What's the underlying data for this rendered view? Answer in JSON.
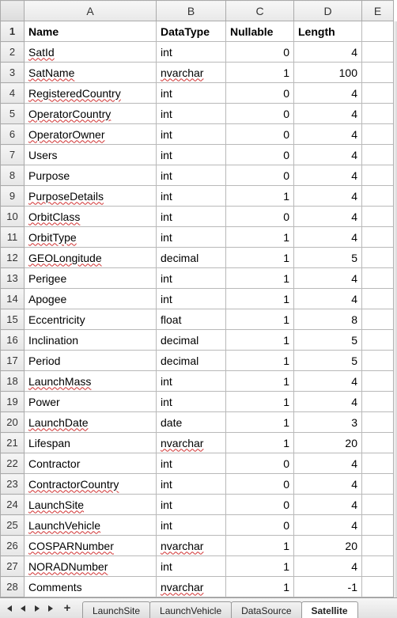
{
  "columns": [
    "A",
    "B",
    "C",
    "D",
    "E"
  ],
  "header_row": {
    "A": "Name",
    "B": "DataType",
    "C": "Nullable",
    "D": "Length"
  },
  "rows": [
    {
      "n": 2,
      "A": "SatId",
      "B": "int",
      "C": 0,
      "D": 4,
      "sqA": true
    },
    {
      "n": 3,
      "A": "SatName",
      "B": "nvarchar",
      "C": 1,
      "D": 100,
      "sqA": true,
      "sqB": true
    },
    {
      "n": 4,
      "A": "RegisteredCountry",
      "B": "int",
      "C": 0,
      "D": 4,
      "sqA": true
    },
    {
      "n": 5,
      "A": "OperatorCountry",
      "B": "int",
      "C": 0,
      "D": 4,
      "sqA": true
    },
    {
      "n": 6,
      "A": "OperatorOwner",
      "B": "int",
      "C": 0,
      "D": 4,
      "sqA": true
    },
    {
      "n": 7,
      "A": "Users",
      "B": "int",
      "C": 0,
      "D": 4
    },
    {
      "n": 8,
      "A": "Purpose",
      "B": "int",
      "C": 0,
      "D": 4
    },
    {
      "n": 9,
      "A": "PurposeDetails",
      "B": "int",
      "C": 1,
      "D": 4,
      "sqA": true
    },
    {
      "n": 10,
      "A": "OrbitClass",
      "B": "int",
      "C": 0,
      "D": 4,
      "sqA": true
    },
    {
      "n": 11,
      "A": "OrbitType",
      "B": "int",
      "C": 1,
      "D": 4,
      "sqA": true
    },
    {
      "n": 12,
      "A": "GEOLongitude",
      "B": "decimal",
      "C": 1,
      "D": 5,
      "sqA": true
    },
    {
      "n": 13,
      "A": "Perigee",
      "B": "int",
      "C": 1,
      "D": 4
    },
    {
      "n": 14,
      "A": "Apogee",
      "B": "int",
      "C": 1,
      "D": 4
    },
    {
      "n": 15,
      "A": "Eccentricity",
      "B": "float",
      "C": 1,
      "D": 8
    },
    {
      "n": 16,
      "A": "Inclination",
      "B": "decimal",
      "C": 1,
      "D": 5
    },
    {
      "n": 17,
      "A": "Period",
      "B": "decimal",
      "C": 1,
      "D": 5
    },
    {
      "n": 18,
      "A": "LaunchMass",
      "B": "int",
      "C": 1,
      "D": 4,
      "sqA": true
    },
    {
      "n": 19,
      "A": "Power",
      "B": "int",
      "C": 1,
      "D": 4
    },
    {
      "n": 20,
      "A": "LaunchDate",
      "B": "date",
      "C": 1,
      "D": 3,
      "sqA": true
    },
    {
      "n": 21,
      "A": "Lifespan",
      "B": "nvarchar",
      "C": 1,
      "D": 20,
      "sqB": true
    },
    {
      "n": 22,
      "A": "Contractor",
      "B": "int",
      "C": 0,
      "D": 4
    },
    {
      "n": 23,
      "A": "ContractorCountry",
      "B": "int",
      "C": 0,
      "D": 4,
      "sqA": true
    },
    {
      "n": 24,
      "A": "LaunchSite",
      "B": "int",
      "C": 0,
      "D": 4,
      "sqA": true
    },
    {
      "n": 25,
      "A": "LaunchVehicle",
      "B": "int",
      "C": 0,
      "D": 4,
      "sqA": true
    },
    {
      "n": 26,
      "A": "COSPARNumber",
      "B": "nvarchar",
      "C": 1,
      "D": 20,
      "sqA": true,
      "sqB": true
    },
    {
      "n": 27,
      "A": "NORADNumber",
      "B": "int",
      "C": 1,
      "D": 4,
      "sqA": true
    },
    {
      "n": 28,
      "A": "Comments",
      "B": "nvarchar",
      "C": 1,
      "D": -1,
      "sqB": true
    }
  ],
  "tabs": [
    {
      "label": "LaunchSite",
      "active": false
    },
    {
      "label": "LaunchVehicle",
      "active": false
    },
    {
      "label": "DataSource",
      "active": false
    },
    {
      "label": "Satellite",
      "active": true
    }
  ],
  "nav": {
    "add": "+"
  }
}
